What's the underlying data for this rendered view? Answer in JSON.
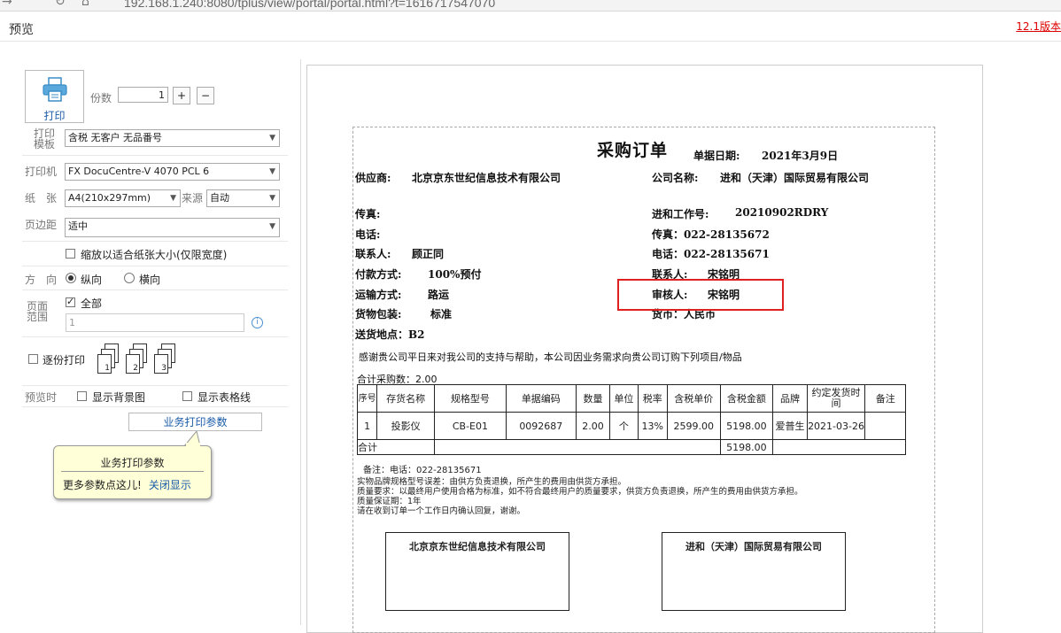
{
  "browser": {
    "url": "192.168.1.240:8080/tplus/view/portal/portal.html?t=1616717547070"
  },
  "header": {
    "title": "预览",
    "version_link": "12.1版本"
  },
  "left_panel": {
    "print_button_label": "打印",
    "copies_label": "份数",
    "copies_value": "1",
    "plus_label": "+",
    "minus_label": "−",
    "template_label": "打印模板",
    "template_value": "含税 无客户 无品番号",
    "printer_label": "打印机",
    "printer_value": "FX DocuCentre-V 4070 PCL 6",
    "paper_label": "纸　张",
    "paper_value": "A4(210x297mm)",
    "source_label": "来源",
    "source_value": "自动",
    "margin_label": "页边距",
    "margin_value": "适中",
    "shrink_label": "缩放以适合纸张大小(仅限宽度)",
    "orientation_label": "方　向",
    "portrait_label": "纵向",
    "landscape_label": "横向",
    "range_label": "页面范围",
    "all_label": "全部",
    "range_value": "1",
    "collate_label": "逐份打印",
    "collate_pages": [
      "1",
      "2",
      "3"
    ],
    "preview_label": "预览时",
    "show_bg_label": "显示背景图",
    "show_grid_label": "显示表格线",
    "biz_params_button": "业务打印参数",
    "tooltip": {
      "title": "业务打印参数",
      "body": "更多参数点这儿!",
      "close": "关闭显示"
    }
  },
  "document": {
    "title": "采购订单",
    "date_label": "单据日期:",
    "date_value": "2021年3月9日",
    "supplier_label": "供应商:",
    "supplier_value": "北京京东世纪信息技术有限公司",
    "company_label": "公司名称:",
    "company_value": "进和（天津）国际贸易有限公司",
    "fax_label": "传真:",
    "work_no_label": "进和工作号:",
    "work_no_value": "20210902RDRY",
    "phone_label": "电话:",
    "fax2": "传真：022-28135672",
    "contact_label": "联系人:",
    "contact_value": "顾正同",
    "phone2": "电话：022-28135671",
    "payment_label": "付款方式:",
    "payment_value": "100%预付",
    "contact2_label": "联系人:",
    "contact2_value": "宋铭明",
    "transport_label": "运输方式:",
    "transport_value": "路运",
    "reviewer_label": "审核人:",
    "reviewer_value": "宋铭明",
    "packing_label": "货物包装:",
    "packing_value": "标准",
    "currency": "货币：人民币",
    "delivery": "送货地点：B2",
    "thanks": "感谢贵公司平日来对我公司的支持与帮助，本公司因业务需求向贵公司订购下列项目/物品",
    "total_qty": "合计采购数：2.00",
    "table": {
      "headers": [
        "序号",
        "存货名称",
        "规格型号",
        "单据编码",
        "数量",
        "单位",
        "税率",
        "含税单价",
        "含税金额",
        "品牌",
        "约定发货时间",
        "备注"
      ],
      "rows": [
        [
          "1",
          "投影仪",
          "CB-E01",
          "0092687",
          "2.00",
          "个",
          "13%",
          "2599.00",
          "5198.00",
          "爱普生",
          "2021-03-26",
          ""
        ]
      ],
      "total_label": "合计",
      "total_amount": "5198.00"
    },
    "remark": "备注：电话：022-28135671",
    "notes": [
      "实物品牌规格型号误差：由供方负责退换，所产生的费用由供货方承担。",
      "质量要求：以最终用户使用合格为标准，如不符合最终用户的质量要求，供货方负责退换，所产生的费用由供货方承担。",
      "质量保证期：1年",
      "请在收到订单一个工作日内确认回复，谢谢。"
    ],
    "sign_left": "北京京东世纪信息技术有限公司",
    "sign_right": "进和（天津）国际贸易有限公司"
  }
}
